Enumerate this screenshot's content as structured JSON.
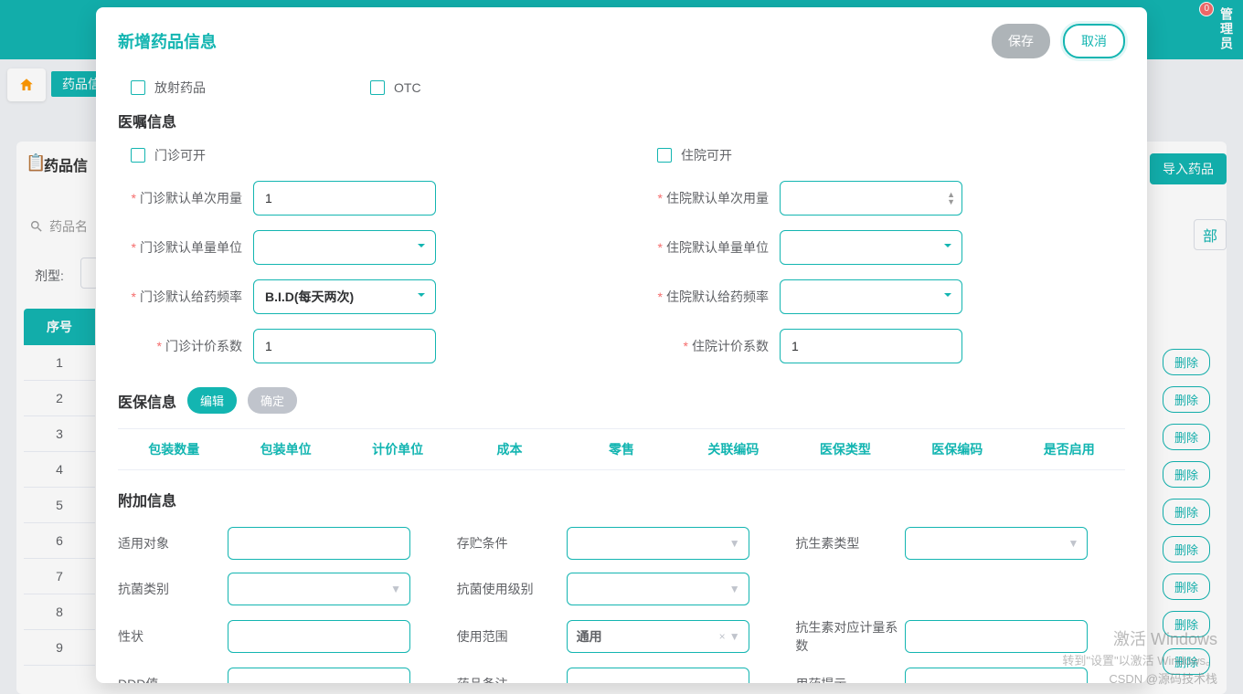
{
  "background": {
    "notification_count": "0",
    "admin_label": "管理员",
    "crumb": "药品信",
    "panel_title": "药品信",
    "import_btn": "导入药品",
    "search_placeholder": "药品名",
    "select_tail": "部",
    "dosage_label": "剂型:",
    "table": {
      "seq_header": "序号",
      "rows": [
        "1",
        "2",
        "3",
        "4",
        "5",
        "6",
        "7",
        "8",
        "9"
      ],
      "delete_label": "删除"
    }
  },
  "modal": {
    "title": "新增药品信息",
    "save": "保存",
    "cancel": "取消",
    "top_checks": {
      "radiopharm": "放射药品",
      "otc": "OTC"
    },
    "order_section": "医嘱信息",
    "outpatient": {
      "openable": "门诊可开",
      "default_dose_label": "门诊默认单次用量",
      "default_dose_value": "1",
      "dose_unit_label": "门诊默认单量单位",
      "freq_label": "门诊默认给药频率",
      "freq_value": "B.I.D(每天两次)",
      "price_coef_label": "门诊计价系数",
      "price_coef_value": "1"
    },
    "inpatient": {
      "openable": "住院可开",
      "default_dose_label": "住院默认单次用量",
      "dose_unit_label": "住院默认单量单位",
      "freq_label": "住院默认给药频率",
      "price_coef_label": "住院计价系数",
      "price_coef_value": "1"
    },
    "medins": {
      "section": "医保信息",
      "edit": "编辑",
      "confirm": "确定",
      "headers": [
        "包装数量",
        "包装单位",
        "计价单位",
        "成本",
        "零售",
        "关联编码",
        "医保类型",
        "医保编码",
        "是否启用"
      ]
    },
    "addinfo": {
      "section": "附加信息",
      "rows": [
        {
          "l": "适用对象",
          "t": "input"
        },
        {
          "l": "存贮条件",
          "t": "select"
        },
        {
          "l": "抗生素类型",
          "t": "select"
        },
        {
          "l": "抗菌类别",
          "t": "select"
        },
        {
          "l": "抗菌使用级别",
          "t": "select"
        },
        {
          "l": "",
          "t": "blank"
        },
        {
          "l": "性状",
          "t": "input"
        },
        {
          "l": "使用范围",
          "t": "tag",
          "v": "通用"
        },
        {
          "l": "抗生素对应计量系数",
          "t": "input"
        },
        {
          "l": "DDD值",
          "t": "input"
        },
        {
          "l": "药品备注",
          "t": "input"
        },
        {
          "l": "用药提示",
          "t": "input"
        }
      ]
    }
  },
  "watermarks": {
    "w1": "激活 Windows",
    "w2": "转到\"设置\"以激活 Windows。",
    "w3": "CSDN @源码技术栈"
  }
}
